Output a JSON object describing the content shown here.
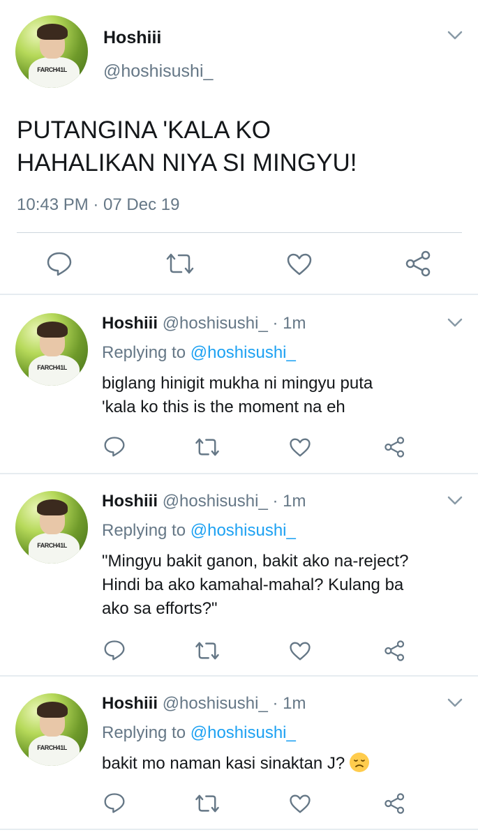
{
  "main_tweet": {
    "name": "Hoshiii",
    "handle": "@hoshisushi_",
    "text_line1": "PUTANGINA 'KALA KO",
    "text_line2": "HAHALIKAN NIYA SI MINGYU!",
    "timestamp": "10:43 PM · 07 Dec 19",
    "avatar_shirt_text": "FARCH41L"
  },
  "replies": [
    {
      "name": "Hoshiii",
      "handle": "@hoshisushi_",
      "dot": "·",
      "time": "1m",
      "replying_label": "Replying to",
      "replying_to": "@hoshisushi_",
      "lines": [
        "biglang hinigit mukha ni mingyu puta",
        "'kala ko this is the moment na eh"
      ],
      "avatar_shirt_text": "FARCH41L"
    },
    {
      "name": "Hoshiii",
      "handle": "@hoshisushi_",
      "dot": "·",
      "time": "1m",
      "replying_label": "Replying to",
      "replying_to": "@hoshisushi_",
      "lines": [
        "\"Mingyu bakit ganon, bakit ako na-reject?",
        "Hindi ba ako kamahal-mahal? Kulang ba",
        "ako sa efforts?\""
      ],
      "avatar_shirt_text": "FARCH41L"
    },
    {
      "name": "Hoshiii",
      "handle": "@hoshisushi_",
      "dot": "·",
      "time": "1m",
      "replying_label": "Replying to",
      "replying_to": "@hoshisushi_",
      "lines": [
        "bakit mo naman kasi sinaktan J?"
      ],
      "emoji": "disappointed-face",
      "avatar_shirt_text": "FARCH41L"
    }
  ],
  "icons": {
    "reply": "reply-icon",
    "retweet": "retweet-icon",
    "like": "heart-icon",
    "share": "share-icon",
    "menu": "chevron-down-icon"
  },
  "colors": {
    "text": "#14171a",
    "secondary": "#657786",
    "link": "#1da1f2",
    "divider": "#e6ecf0"
  }
}
